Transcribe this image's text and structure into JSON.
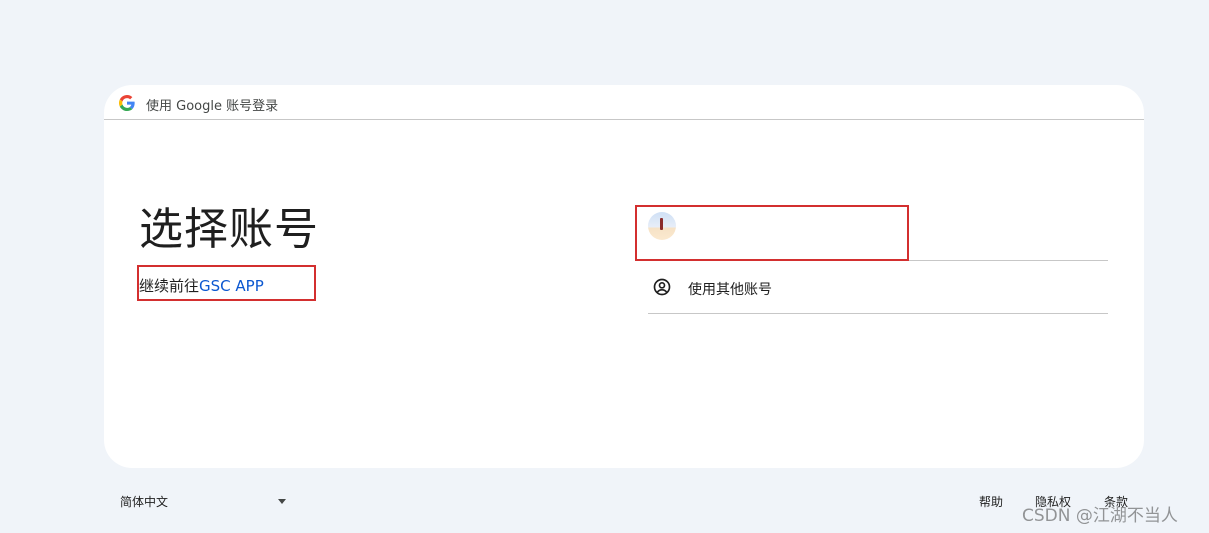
{
  "header": {
    "text": "使用 Google 账号登录"
  },
  "main": {
    "title": "选择账号",
    "subtitle_prefix": "继续前往",
    "app_name": "GSC APP"
  },
  "accounts": {
    "other_account_label": "使用其他账号"
  },
  "footer": {
    "language": "简体中文",
    "help": "帮助",
    "privacy": "隐私权",
    "terms": "条款"
  },
  "watermark": "CSDN @江湖不当人",
  "colors": {
    "page_bg": "#f0f4f9",
    "card_bg": "#ffffff",
    "link": "#0b57d0",
    "highlight_box": "#d32f2f",
    "divider": "#c7c7c7"
  },
  "icons": {
    "header": "google-g-icon",
    "other_account": "person-circle-icon",
    "language_dropdown": "caret-down-icon"
  }
}
